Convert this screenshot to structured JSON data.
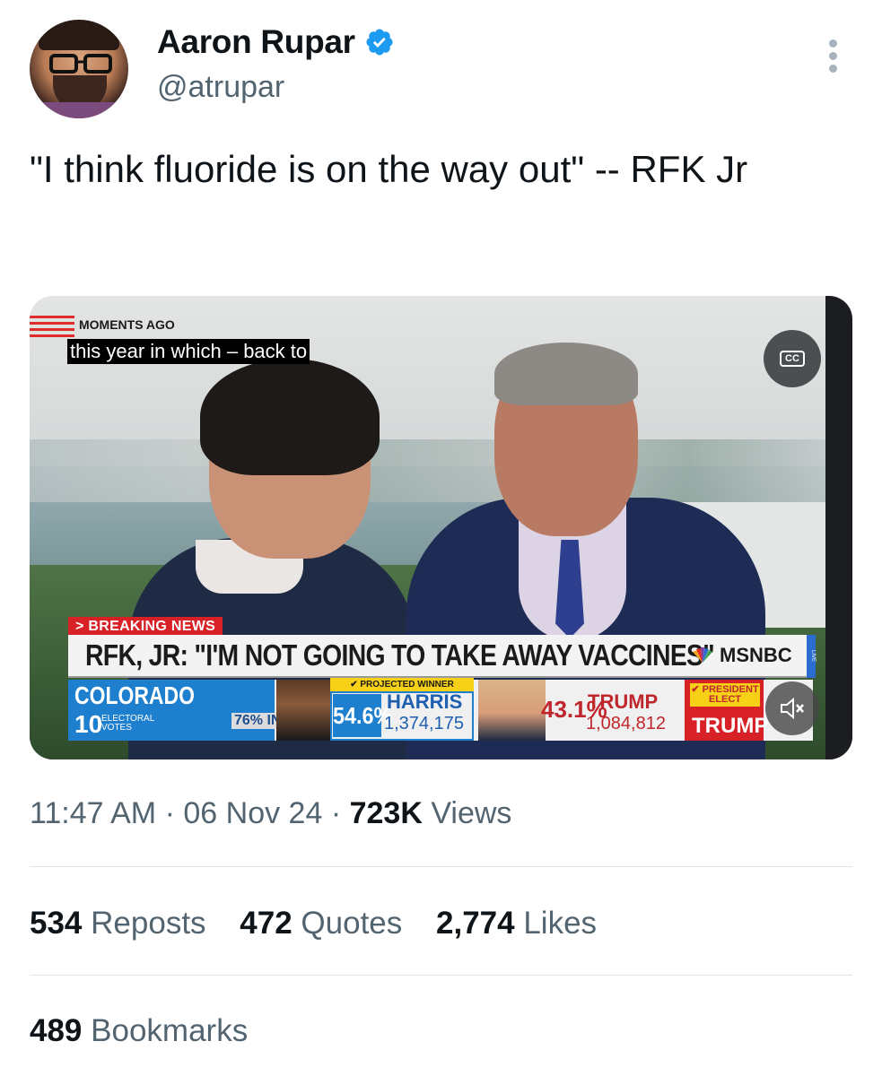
{
  "author": {
    "name": "Aaron Rupar",
    "handle": "@atrupar",
    "verified": true,
    "avatar_icon": "avatar"
  },
  "menu_icon": "more-vertical-icon",
  "tweet": {
    "text": "\"I think fluoride is on the way out\" -- RFK Jr"
  },
  "video": {
    "moments_label": "MOMENTS AGO",
    "caption": "this year in which – back to",
    "cc_label": "CC",
    "breaking_label": "> BREAKING NEWS",
    "headline": "RFK, JR: \"I'M NOT GOING TO TAKE AWAY VACCINES\"",
    "network": "MSNBC",
    "live_label": "LIVE",
    "results": {
      "state": "COLORADO",
      "electoral_votes": "10",
      "electoral_label": "ELECTORAL VOTES",
      "percent_in": "76% IN",
      "projected_label": "✔ PROJECTED WINNER",
      "harris_pct": "54.6%",
      "harris_name": "HARRIS",
      "harris_votes": "1,374,175",
      "trump_pct": "43.1%",
      "trump_name": "TRUMP",
      "trump_votes": "1,084,812",
      "president_elect_label": "✔ PRESIDENT ELECT",
      "president_elect_name": "TRUMP"
    },
    "mute_icon": "🔇"
  },
  "meta": {
    "time": "11:47 AM",
    "date": "06 Nov 24",
    "views_count": "723K",
    "views_label": "Views",
    "separator": "·"
  },
  "stats": {
    "reposts_count": "534",
    "reposts_label": "Reposts",
    "quotes_count": "472",
    "quotes_label": "Quotes",
    "likes_count": "2,774",
    "likes_label": "Likes",
    "bookmarks_count": "489",
    "bookmarks_label": "Bookmarks"
  },
  "colors": {
    "verified_blue": "#1d9bf0",
    "text_primary": "#0f1419",
    "text_secondary": "#536471",
    "msnbc_red": "#d72126",
    "harris_blue": "#1f7fcf",
    "trump_red": "#c0272d"
  }
}
